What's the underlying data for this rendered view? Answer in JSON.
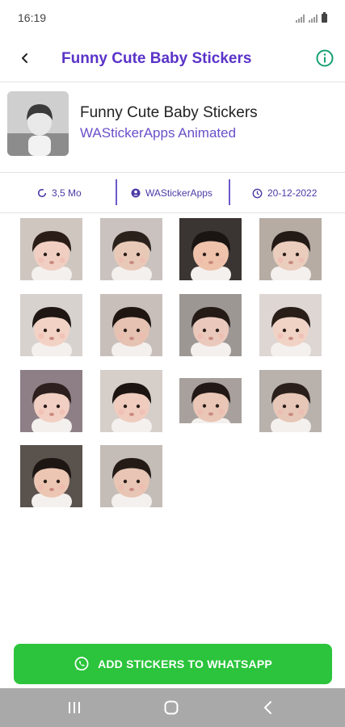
{
  "status_bar": {
    "time": "16:19",
    "icons": [
      "signal-icon",
      "signal-icon",
      "battery-icon"
    ]
  },
  "app_bar": {
    "title": "Funny Cute Baby Stickers",
    "back_icon": "back-arrow-icon",
    "info_icon": "info-icon"
  },
  "pack": {
    "name": "Funny Cute Baby Stickers",
    "publisher": "WAStickerApps Animated"
  },
  "details": {
    "size": "3,5 Mo",
    "author": "WAStickerApps",
    "date": "20-12-2022"
  },
  "stickers": [
    {
      "name": "sticker-1",
      "bg": "#cfc6c0",
      "skin": "#f0cfc2",
      "hair": "#2a1d18"
    },
    {
      "name": "sticker-2",
      "bg": "#c9c2be",
      "skin": "#e8c9b8",
      "hair": "#2b211b"
    },
    {
      "name": "sticker-3",
      "bg": "#3a3432",
      "skin": "#eec2ab",
      "hair": "#1a1412"
    },
    {
      "name": "sticker-4",
      "bg": "#b6aca4",
      "skin": "#eacdbd",
      "hair": "#231915"
    },
    {
      "name": "sticker-5",
      "bg": "#d8d2cf",
      "skin": "#f3d2c6",
      "hair": "#1e1714"
    },
    {
      "name": "sticker-6",
      "bg": "#c8bfbb",
      "skin": "#e6c2b2",
      "hair": "#1f1612"
    },
    {
      "name": "sticker-7",
      "bg": "#9d9794",
      "skin": "#eac9bc",
      "hair": "#241a16"
    },
    {
      "name": "sticker-8",
      "bg": "#ddd6d3",
      "skin": "#f1d3c6",
      "hair": "#2a1e19"
    },
    {
      "name": "sticker-9",
      "bg": "#8e7f86",
      "skin": "#f2cfc3",
      "hair": "#2c1f1d"
    },
    {
      "name": "sticker-10",
      "bg": "#d6cec9",
      "skin": "#efccbe",
      "hair": "#1c1411"
    },
    {
      "name": "sticker-11",
      "bg": "#a7a09c",
      "skin": "#e9c6b6",
      "hair": "#221815"
    },
    {
      "name": "sticker-12",
      "bg": "#b8b1ac",
      "skin": "#e7c7b8",
      "hair": "#2a1f1a"
    },
    {
      "name": "sticker-13",
      "bg": "#5a524d",
      "skin": "#ecc6b3",
      "hair": "#1e1613"
    },
    {
      "name": "sticker-14",
      "bg": "#c4bcb6",
      "skin": "#e8c5b4",
      "hair": "#241b17"
    }
  ],
  "add_button": {
    "label": "ADD STICKERS TO WHATSAPP",
    "icon": "whatsapp-icon"
  },
  "nav_bar": {
    "icons": [
      "recent-apps-icon",
      "home-icon",
      "back-icon"
    ]
  },
  "colors": {
    "accent": "#5a33c8",
    "info": "#16a070",
    "button": "#2bc43c",
    "nav": "#a9a9a9"
  }
}
